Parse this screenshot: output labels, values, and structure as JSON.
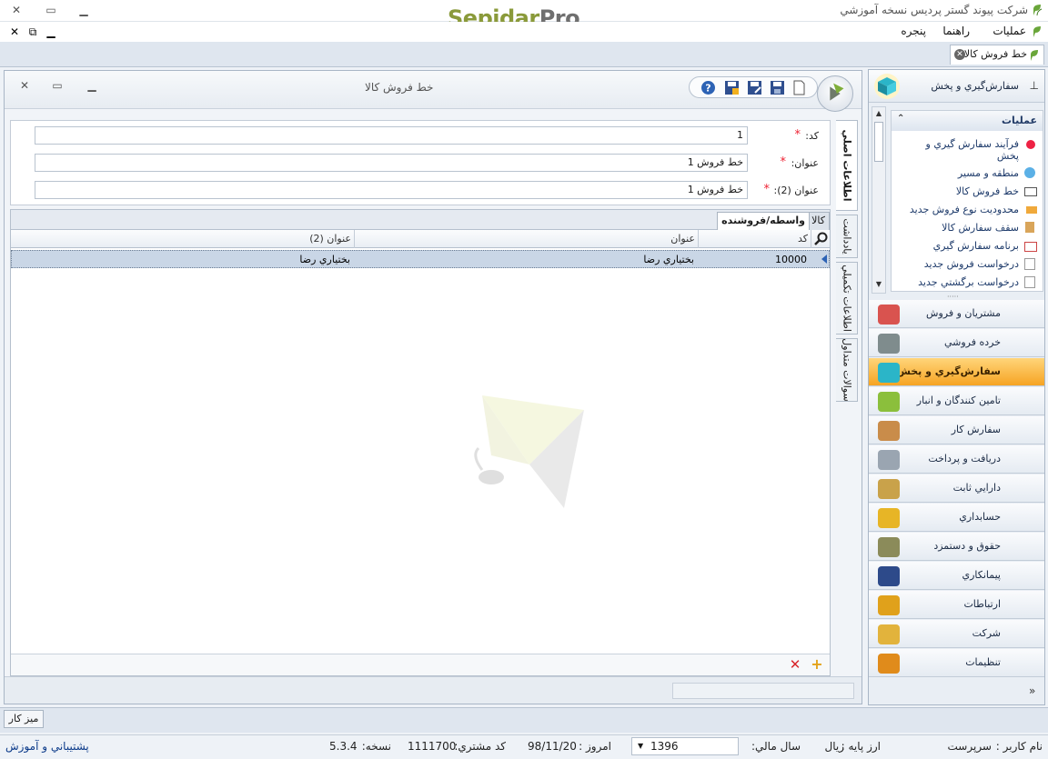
{
  "app": {
    "title": "شرکت پیوند گستر پردیس نسخه آموزشي",
    "logo_main": "Sepidar",
    "logo_pro": "Pro"
  },
  "menu": {
    "items": [
      "عمليات",
      "راهنما",
      "پنجره"
    ]
  },
  "tab": {
    "label": "خط فروش كالا"
  },
  "form": {
    "title": "خط فروش كالا",
    "fields": [
      {
        "label": "كد:",
        "value": "1"
      },
      {
        "label": "عنوان:",
        "value": "خط فروش 1"
      },
      {
        "label": "عنوان (2):",
        "value": "خط فروش 1"
      }
    ],
    "side_tabs": [
      "اطلاعات اصلي",
      "يادداشت",
      "اطلاعات تكميلي",
      "سوالات متداول"
    ],
    "sub_tabs": [
      "كالا",
      "واسطه/فروشنده"
    ],
    "grid": {
      "columns": [
        "كد",
        "عنوان",
        "عنوان (2)"
      ],
      "rows": [
        {
          "code": "10000",
          "title": "بختياري رضا",
          "title2": "بختياري رضا"
        }
      ]
    }
  },
  "nav": {
    "header": "سفارش‌گيري و پخش",
    "ops_title": "عمليات",
    "ops": [
      "فرآيند سفارش گيري و پخش",
      "منطقه و مسير",
      "خط فروش كالا",
      "محدوديت نوع فروش جديد",
      "سقف سفارش كالا",
      "برنامه سفارش گيري",
      "درخواست فروش جديد",
      "درخواست برگشتي جديد"
    ],
    "modules": [
      {
        "label": "مشتريان و فروش",
        "color": "#d9534f"
      },
      {
        "label": "خرده فروشي",
        "color": "#7f8c8d"
      },
      {
        "label": "سفارش‌گيري و پخش",
        "color": "#2bb5c8",
        "active": true
      },
      {
        "label": "تامين كنندگان و انبار",
        "color": "#8bbf3c"
      },
      {
        "label": "سفارش كار",
        "color": "#c98c4a"
      },
      {
        "label": "دريافت و پرداخت",
        "color": "#9aa5b1"
      },
      {
        "label": "دارايي ثابت",
        "color": "#c9a24a"
      },
      {
        "label": "حسابداري",
        "color": "#e7b526"
      },
      {
        "label": "حقوق و دستمزد",
        "color": "#8b8b5a"
      },
      {
        "label": "پيمانكاري",
        "color": "#2d4a8a"
      },
      {
        "label": "ارتباطات",
        "color": "#e0a11b"
      },
      {
        "label": "شركت",
        "color": "#e2b33c"
      },
      {
        "label": "تنظيمات",
        "color": "#e08b1b"
      }
    ]
  },
  "taskbar": {
    "desk": "ميز كار"
  },
  "status": {
    "user_label": "نام كاربر :",
    "user": "سرپرست",
    "currency_label": "ارز پايه :",
    "currency": "ريال",
    "fiscal_label": "سال مالي:",
    "fiscal_year": "1396",
    "today_label": "امروز :",
    "today": "98/11/20",
    "customer_label": "كد مشتري:",
    "customer_code": "1111700",
    "version_label": "نسخه:",
    "version": "5.3.4",
    "support": "پشتيباني و آموزش"
  }
}
